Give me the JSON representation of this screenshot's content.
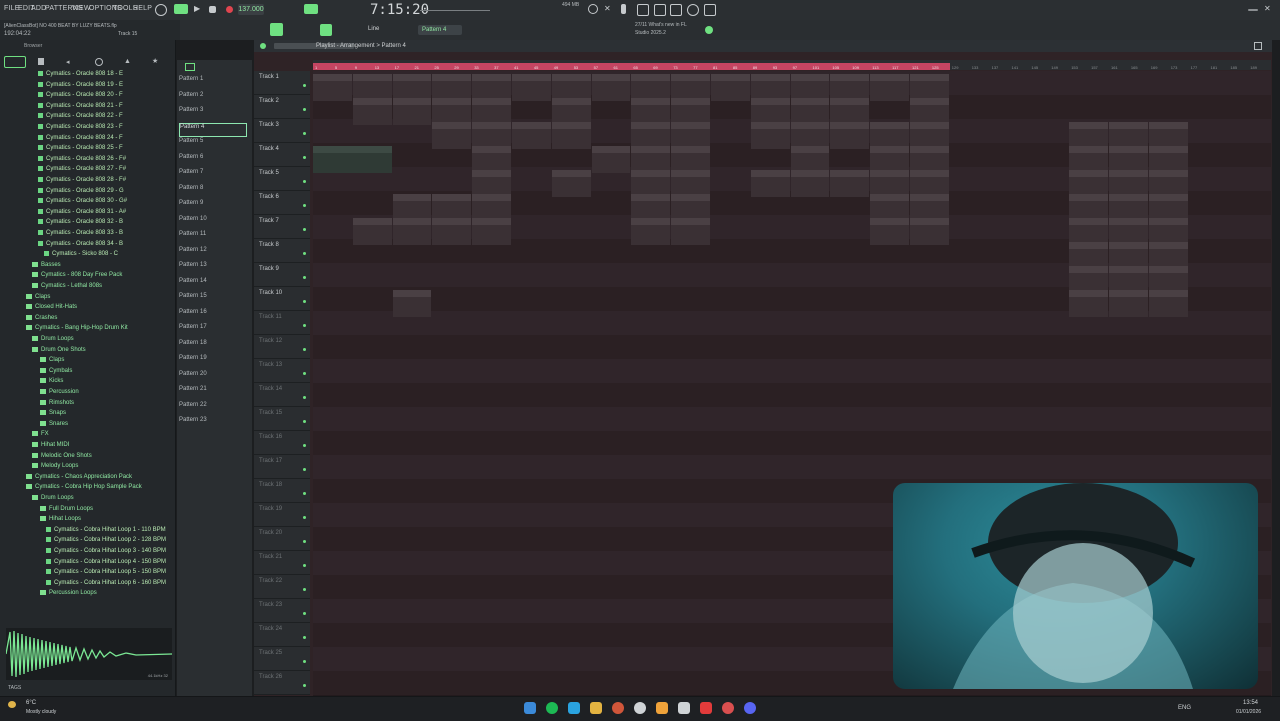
{
  "menu": [
    "FILE",
    "EDIT",
    "ADD",
    "PATTERNS",
    "VIEW",
    "OPTIONS",
    "TOOLS",
    "HELP"
  ],
  "tempo": "137.000",
  "time_display": "7:15:20",
  "cpu": "494 MB",
  "hint_line1": "[AlienClassBot] NO 400 BEAT BY LUZY BEATS.flp",
  "hint_line2": "192:04:22",
  "hint_track": "Track 15",
  "snap_mode": "Line",
  "pattern_selector": "Pattern 4",
  "news": {
    "line1": "27/11 What's new in FL",
    "line2": "Studio 2025.2"
  },
  "playlist_title": "Playlist - Arrangement > Pattern 4",
  "browser_label": "Browser",
  "browser_items": [
    {
      "label": "Cymatics - Oracle 808 18 - E",
      "type": "file",
      "indent": 38
    },
    {
      "label": "Cymatics - Oracle 808 19 - E",
      "type": "file",
      "indent": 38
    },
    {
      "label": "Cymatics - Oracle 808 20 - F",
      "type": "file",
      "indent": 38
    },
    {
      "label": "Cymatics - Oracle 808 21 - F",
      "type": "file",
      "indent": 38
    },
    {
      "label": "Cymatics - Oracle 808 22 - F",
      "type": "file",
      "indent": 38
    },
    {
      "label": "Cymatics - Oracle 808 23 - F",
      "type": "file",
      "indent": 38
    },
    {
      "label": "Cymatics - Oracle 808 24 - F",
      "type": "file",
      "indent": 38
    },
    {
      "label": "Cymatics - Oracle 808 25 - F",
      "type": "file",
      "indent": 38
    },
    {
      "label": "Cymatics - Oracle 808 26 - F#",
      "type": "file",
      "indent": 38
    },
    {
      "label": "Cymatics - Oracle 808 27 - F#",
      "type": "file",
      "indent": 38
    },
    {
      "label": "Cymatics - Oracle 808 28 - F#",
      "type": "file",
      "indent": 38
    },
    {
      "label": "Cymatics - Oracle 808 29 - G",
      "type": "file",
      "indent": 38
    },
    {
      "label": "Cymatics - Oracle 808 30 - G#",
      "type": "file",
      "indent": 38
    },
    {
      "label": "Cymatics - Oracle 808 31 - A#",
      "type": "file",
      "indent": 38
    },
    {
      "label": "Cymatics - Oracle 808 32 - B",
      "type": "file",
      "indent": 38
    },
    {
      "label": "Cymatics - Oracle 808 33 - B",
      "type": "file",
      "indent": 38
    },
    {
      "label": "Cymatics - Oracle 808 34 - B",
      "type": "file",
      "indent": 38
    },
    {
      "label": "Cymatics - Sicko 808 - C",
      "type": "file",
      "indent": 44
    },
    {
      "label": "Basses",
      "type": "folder",
      "indent": 32
    },
    {
      "label": "Cymatics - 808 Day Free Pack",
      "type": "folder",
      "indent": 32
    },
    {
      "label": "Cymatics - Lethal 808s",
      "type": "folder",
      "indent": 32
    },
    {
      "label": "Claps",
      "type": "folder",
      "indent": 26
    },
    {
      "label": "Closed Hit-Hats",
      "type": "folder",
      "indent": 26
    },
    {
      "label": "Crashes",
      "type": "folder",
      "indent": 26
    },
    {
      "label": "Cymatics - Bang Hip-Hop Drum Kit",
      "type": "folder",
      "indent": 26
    },
    {
      "label": "Drum Loops",
      "type": "folder",
      "indent": 32
    },
    {
      "label": "Drum One Shots",
      "type": "folder",
      "indent": 32
    },
    {
      "label": "Claps",
      "type": "folder",
      "indent": 40
    },
    {
      "label": "Cymbals",
      "type": "folder",
      "indent": 40
    },
    {
      "label": "Kicks",
      "type": "folder",
      "indent": 40
    },
    {
      "label": "Percussion",
      "type": "folder",
      "indent": 40
    },
    {
      "label": "Rimshots",
      "type": "folder",
      "indent": 40
    },
    {
      "label": "Snaps",
      "type": "folder",
      "indent": 40
    },
    {
      "label": "Snares",
      "type": "folder",
      "indent": 40
    },
    {
      "label": "FX",
      "type": "folder",
      "indent": 32
    },
    {
      "label": "Hihat MIDI",
      "type": "folder",
      "indent": 32
    },
    {
      "label": "Melodic One Shots",
      "type": "folder",
      "indent": 32
    },
    {
      "label": "Melody Loops",
      "type": "folder",
      "indent": 32
    },
    {
      "label": "Cymatics - Chaos Appreciation Pack",
      "type": "folder",
      "indent": 26
    },
    {
      "label": "Cymatics - Cobra Hip Hop Sample Pack",
      "type": "folder",
      "indent": 26
    },
    {
      "label": "Drum Loops",
      "type": "folder",
      "indent": 32
    },
    {
      "label": "Full Drum Loops",
      "type": "folder",
      "indent": 40
    },
    {
      "label": "Hihat Loops",
      "type": "folder",
      "indent": 40
    },
    {
      "label": "Cymatics - Cobra Hihat Loop 1 - 110 BPM",
      "type": "file",
      "indent": 46
    },
    {
      "label": "Cymatics - Cobra Hihat Loop 2 - 128 BPM",
      "type": "file",
      "indent": 46
    },
    {
      "label": "Cymatics - Cobra Hihat Loop 3 - 140 BPM",
      "type": "file",
      "indent": 46
    },
    {
      "label": "Cymatics - Cobra Hihat Loop 4 - 150 BPM",
      "type": "file",
      "indent": 46
    },
    {
      "label": "Cymatics - Cobra Hihat Loop 5 - 150 BPM",
      "type": "file",
      "indent": 46
    },
    {
      "label": "Cymatics - Cobra Hihat Loop 6 - 160 BPM",
      "type": "file",
      "indent": 46
    },
    {
      "label": "Percussion Loops",
      "type": "folder",
      "indent": 40
    }
  ],
  "tags_label": "TAGS",
  "sample_info": "44.1kHz 32",
  "patterns": [
    "Pattern 1",
    "Pattern 2",
    "Pattern 3",
    "Pattern 4",
    "Pattern 5",
    "Pattern 6",
    "Pattern 7",
    "Pattern 8",
    "Pattern 9",
    "Pattern 10",
    "Pattern 11",
    "Pattern 12",
    "Pattern 13",
    "Pattern 14",
    "Pattern 15",
    "Pattern 16",
    "Pattern 17",
    "Pattern 18",
    "Pattern 19",
    "Pattern 20",
    "Pattern 21",
    "Pattern 22",
    "Pattern 23"
  ],
  "selected_pattern_index": 3,
  "tracks": [
    "Track 1",
    "Track 2",
    "Track 3",
    "Track 4",
    "Track 5",
    "Track 6",
    "Track 7",
    "Track 8",
    "Track 9",
    "Track 10",
    "Track 11",
    "Track 12",
    "Track 13",
    "Track 14",
    "Track 15",
    "Track 16",
    "Track 17",
    "Track 18",
    "Track 19",
    "Track 20",
    "Track 21",
    "Track 22",
    "Track 23",
    "Track 24",
    "Track 25",
    "Track 26"
  ],
  "ruler_numbers": [
    "1",
    "5",
    "9",
    "13",
    "17",
    "21",
    "25",
    "29",
    "33",
    "37",
    "41",
    "45",
    "49",
    "53",
    "57",
    "61",
    "65",
    "69",
    "73",
    "77",
    "81",
    "85",
    "89",
    "93",
    "97",
    "101",
    "105",
    "109",
    "113",
    "117",
    "121",
    "125",
    "129",
    "133",
    "137",
    "141",
    "145",
    "149",
    "153",
    "157",
    "161",
    "165",
    "169",
    "173",
    "177",
    "181",
    "185",
    "189"
  ],
  "clips": [
    {
      "track": 0,
      "label": "Pattern 3",
      "start": 0,
      "len": 2
    },
    {
      "track": 0,
      "label": "Pattern 4",
      "start": 2,
      "len": 2
    },
    {
      "track": 0,
      "label": "Pattern 3",
      "start": 4,
      "len": 2
    },
    {
      "track": 0,
      "label": "Pattern 4",
      "start": 6,
      "len": 2
    },
    {
      "track": 0,
      "label": "Pattern 3",
      "start": 8,
      "len": 2
    },
    {
      "track": 0,
      "label": "Pattern 4",
      "start": 10,
      "len": 2
    },
    {
      "track": 0,
      "label": "Pattern 4",
      "start": 12,
      "len": 2
    },
    {
      "track": 0,
      "label": "Pattern 4",
      "start": 14,
      "len": 2
    },
    {
      "track": 0,
      "label": "Pattern 5",
      "start": 16,
      "len": 2
    },
    {
      "track": 0,
      "label": "Pattern 4",
      "start": 18,
      "len": 2
    },
    {
      "track": 0,
      "label": "Pattern 5",
      "start": 20,
      "len": 2
    },
    {
      "track": 0,
      "label": "Pattern 4",
      "start": 22,
      "len": 2
    },
    {
      "track": 0,
      "label": "Pattern 6",
      "start": 24,
      "len": 2
    },
    {
      "track": 0,
      "label": "Pattern 4",
      "start": 26,
      "len": 2
    },
    {
      "track": 0,
      "label": "Pattern 7",
      "start": 28,
      "len": 2
    },
    {
      "track": 0,
      "label": "Pattern 3",
      "start": 30,
      "len": 2
    },
    {
      "track": 1,
      "label": "Pattern 15",
      "start": 2,
      "len": 2
    },
    {
      "track": 1,
      "label": "Pattern 15",
      "start": 4,
      "len": 2
    },
    {
      "track": 1,
      "label": "Pattern 15",
      "start": 6,
      "len": 2
    },
    {
      "track": 1,
      "label": "Pattern 16",
      "start": 8,
      "len": 2
    },
    {
      "track": 1,
      "label": "Pattern 17",
      "start": 12,
      "len": 2
    },
    {
      "track": 1,
      "label": "Pattern 16",
      "start": 16,
      "len": 2
    },
    {
      "track": 1,
      "label": "Pattern 16",
      "start": 18,
      "len": 2
    },
    {
      "track": 1,
      "label": "Patt. 16",
      "start": 22,
      "len": 2
    },
    {
      "track": 1,
      "label": "Pattern 16",
      "start": 24,
      "len": 2
    },
    {
      "track": 1,
      "label": "Pattern 17",
      "start": 26,
      "len": 2
    },
    {
      "track": 1,
      "label": "Pattern 16",
      "start": 30,
      "len": 2
    },
    {
      "track": 2,
      "label": "Pattern 8",
      "start": 6,
      "len": 2
    },
    {
      "track": 2,
      "label": "Pattern 10",
      "start": 8,
      "len": 2
    },
    {
      "track": 2,
      "label": "Pattern 9",
      "start": 10,
      "len": 2
    },
    {
      "track": 2,
      "label": "Pattern 9",
      "start": 12,
      "len": 2
    },
    {
      "track": 2,
      "label": "Pattern 8",
      "start": 16,
      "len": 2
    },
    {
      "track": 2,
      "label": "Pattern 8",
      "start": 18,
      "len": 2
    },
    {
      "track": 2,
      "label": "Patt. 22",
      "start": 22,
      "len": 2
    },
    {
      "track": 2,
      "label": "Pattern 22",
      "start": 24,
      "len": 2
    },
    {
      "track": 2,
      "label": "Pattern 23",
      "start": 26,
      "len": 2
    },
    {
      "track": 2,
      "label": "Pattern 22",
      "start": 28,
      "len": 2
    },
    {
      "track": 2,
      "label": "Pattern 22",
      "start": 30,
      "len": 2
    },
    {
      "track": 2,
      "label": "Pattern 1",
      "start": 38,
      "len": 2
    },
    {
      "track": 2,
      "label": "Pattern 1",
      "start": 40,
      "len": 2
    },
    {
      "track": 2,
      "label": "Pattern 1",
      "start": 42,
      "len": 2
    },
    {
      "track": 3,
      "label": "Fruity Stereo Sh...100 - Mix level",
      "start": 0,
      "len": 4,
      "audio": true
    },
    {
      "track": 3,
      "label": "Pattern 12",
      "start": 8,
      "len": 2
    },
    {
      "track": 3,
      "label": "Pattern 12",
      "start": 14,
      "len": 2
    },
    {
      "track": 3,
      "label": "Pattern 12",
      "start": 16,
      "len": 2
    },
    {
      "track": 3,
      "label": "Pattern 12",
      "start": 18,
      "len": 2
    },
    {
      "track": 3,
      "label": "Pattern 12",
      "start": 24,
      "len": 2
    },
    {
      "track": 3,
      "label": "Pattern 12",
      "start": 28,
      "len": 2
    },
    {
      "track": 3,
      "label": "Pattern 12",
      "start": 30,
      "len": 2
    },
    {
      "track": 3,
      "label": "Pattern 8",
      "start": 38,
      "len": 2
    },
    {
      "track": 3,
      "label": "Pattern 8",
      "start": 40,
      "len": 2
    },
    {
      "track": 3,
      "label": "Pattern 8",
      "start": 42,
      "len": 2
    },
    {
      "track": 4,
      "label": "Pattern 13",
      "start": 8,
      "len": 2
    },
    {
      "track": 4,
      "label": "Pattern 14",
      "start": 12,
      "len": 2
    },
    {
      "track": 4,
      "label": "Pattern 13",
      "start": 16,
      "len": 2
    },
    {
      "track": 4,
      "label": "Pattern 13",
      "start": 18,
      "len": 2
    },
    {
      "track": 4,
      "label": "Patt. 13",
      "start": 22,
      "len": 2
    },
    {
      "track": 4,
      "label": "Pattern 13",
      "start": 24,
      "len": 2
    },
    {
      "track": 4,
      "label": "Pattern 13",
      "start": 26,
      "len": 2
    },
    {
      "track": 4,
      "label": "Pattern 13",
      "start": 28,
      "len": 2
    },
    {
      "track": 4,
      "label": "Pattern 13",
      "start": 30,
      "len": 2
    },
    {
      "track": 4,
      "label": "Pattern 12",
      "start": 38,
      "len": 2
    },
    {
      "track": 4,
      "label": "Pattern 12",
      "start": 40,
      "len": 2
    },
    {
      "track": 4,
      "label": "Pattern 12",
      "start": 42,
      "len": 2
    },
    {
      "track": 5,
      "label": "Pattern 20",
      "start": 4,
      "len": 2
    },
    {
      "track": 5,
      "label": "Pattern 20",
      "start": 6,
      "len": 2
    },
    {
      "track": 5,
      "label": "Pattern 20",
      "start": 8,
      "len": 2
    },
    {
      "track": 5,
      "label": "Pattern 20",
      "start": 16,
      "len": 2
    },
    {
      "track": 5,
      "label": "Pattern 20",
      "start": 18,
      "len": 2
    },
    {
      "track": 5,
      "label": "Pattern 20",
      "start": 28,
      "len": 2
    },
    {
      "track": 5,
      "label": "Pattern 20",
      "start": 30,
      "len": 2
    },
    {
      "track": 5,
      "label": "Pattern 13",
      "start": 38,
      "len": 2
    },
    {
      "track": 5,
      "label": "Pattern 13",
      "start": 40,
      "len": 2
    },
    {
      "track": 5,
      "label": "Pattern 13",
      "start": 42,
      "len": 2
    },
    {
      "track": 6,
      "label": "Pattern 18",
      "start": 2,
      "len": 2
    },
    {
      "track": 6,
      "label": "Pattern 18",
      "start": 4,
      "len": 2
    },
    {
      "track": 6,
      "label": "Pattern 18",
      "start": 6,
      "len": 2
    },
    {
      "track": 6,
      "label": "Pattern 18",
      "start": 8,
      "len": 2
    },
    {
      "track": 6,
      "label": "Pattern 18",
      "start": 16,
      "len": 2
    },
    {
      "track": 6,
      "label": "Pattern 18",
      "start": 18,
      "len": 2
    },
    {
      "track": 6,
      "label": "Pattern 18",
      "start": 28,
      "len": 2
    },
    {
      "track": 6,
      "label": "Pattern 18",
      "start": 30,
      "len": 2
    },
    {
      "track": 6,
      "label": "Pattern 15",
      "start": 38,
      "len": 2
    },
    {
      "track": 6,
      "label": "Pattern 15",
      "start": 40,
      "len": 2
    },
    {
      "track": 6,
      "label": "Pattern 15",
      "start": 42,
      "len": 2
    },
    {
      "track": 7,
      "label": "Pattern 18",
      "start": 38,
      "len": 2
    },
    {
      "track": 7,
      "label": "Pattern 18",
      "start": 40,
      "len": 2
    },
    {
      "track": 7,
      "label": "Pattern 18",
      "start": 42,
      "len": 2
    },
    {
      "track": 8,
      "label": "Pattern 19",
      "start": 38,
      "len": 2
    },
    {
      "track": 8,
      "label": "Pattern 19",
      "start": 40,
      "len": 2
    },
    {
      "track": 8,
      "label": "Pattern 19",
      "start": 42,
      "len": 2
    },
    {
      "track": 9,
      "label": "Pattern 13",
      "start": 4,
      "len": 2
    },
    {
      "track": 9,
      "label": "Pattern 18",
      "start": 38,
      "len": 2
    },
    {
      "track": 9,
      "label": "Pattern 18",
      "start": 40,
      "len": 2
    },
    {
      "track": 9,
      "label": "Pattern 18",
      "start": 42,
      "len": 2
    }
  ],
  "taskbar": {
    "weather_temp": "6°C",
    "weather_desc": "Mostly cloudy",
    "lang": "ENG",
    "time": "13:54",
    "date": "01/01/2026"
  },
  "colors": {
    "accent": "#8de7b0",
    "ruler_active": "#c44562",
    "playlist_bg": "#2f2326",
    "browser_text": "#b9eab3"
  }
}
